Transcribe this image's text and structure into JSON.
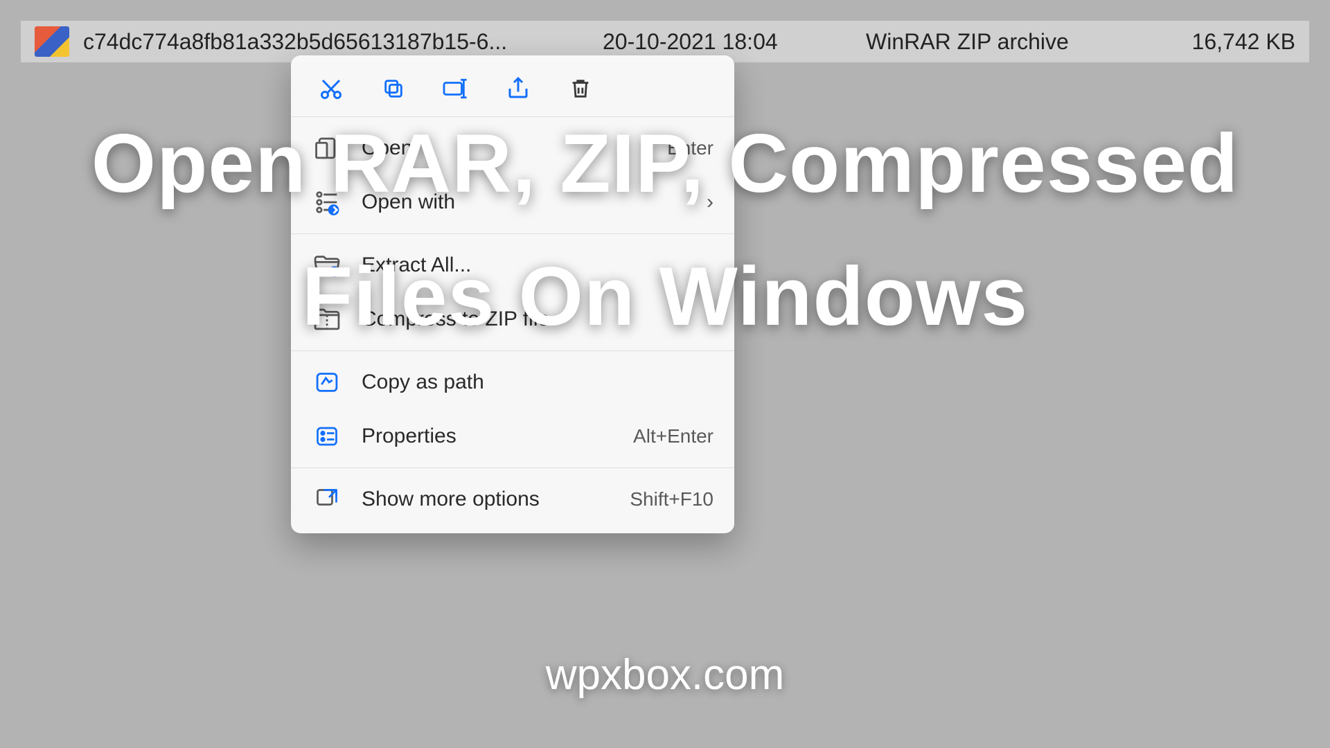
{
  "file": {
    "name": "c74dc774a8fb81a332b5d65613187b15-6...",
    "date": "20-10-2021 18:04",
    "type": "WinRAR ZIP archive",
    "size": "16,742 KB"
  },
  "menu": {
    "open": {
      "label": "Open",
      "shortcut": "Enter"
    },
    "open_with": {
      "label": "Open with",
      "has_submenu": true
    },
    "extract_all": {
      "label": "Extract All..."
    },
    "compress_to_zip": {
      "label": "Compress to ZIP file"
    },
    "copy_as_path": {
      "label": "Copy as path"
    },
    "properties": {
      "label": "Properties",
      "shortcut": "Alt+Enter"
    },
    "show_more": {
      "label": "Show more options",
      "shortcut": "Shift+F10"
    }
  },
  "overlay": {
    "headline": "Open RAR, ZIP, Compressed Files On Windows",
    "watermark": "wpxbox.com"
  }
}
